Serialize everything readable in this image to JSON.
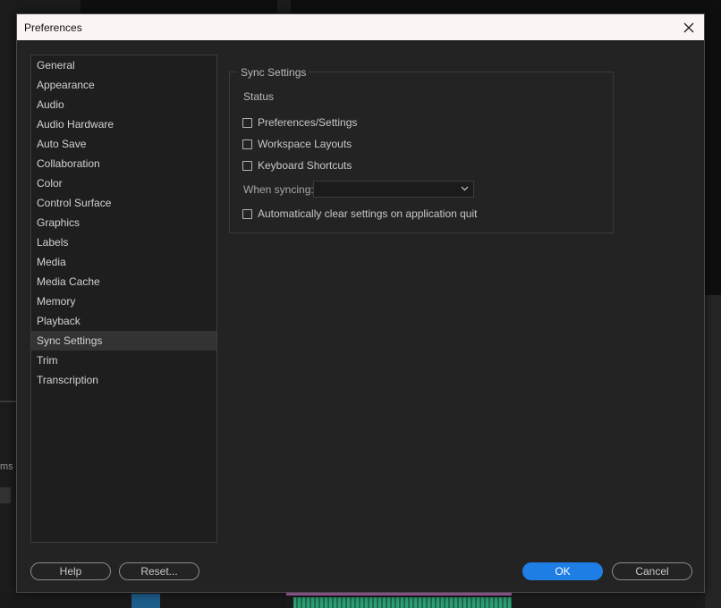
{
  "window": {
    "title": "Preferences"
  },
  "sidebar": {
    "items": [
      {
        "label": "General"
      },
      {
        "label": "Appearance"
      },
      {
        "label": "Audio"
      },
      {
        "label": "Audio Hardware"
      },
      {
        "label": "Auto Save"
      },
      {
        "label": "Collaboration"
      },
      {
        "label": "Color"
      },
      {
        "label": "Control Surface"
      },
      {
        "label": "Graphics"
      },
      {
        "label": "Labels"
      },
      {
        "label": "Media"
      },
      {
        "label": "Media Cache"
      },
      {
        "label": "Memory"
      },
      {
        "label": "Playback"
      },
      {
        "label": "Sync Settings"
      },
      {
        "label": "Trim"
      },
      {
        "label": "Transcription"
      }
    ],
    "selected": "Sync Settings"
  },
  "sync": {
    "group_title": "Sync Settings",
    "status_label": "Status",
    "checkboxes": [
      {
        "label": "Preferences/Settings",
        "checked": false
      },
      {
        "label": "Workspace Layouts",
        "checked": false
      },
      {
        "label": "Keyboard Shortcuts",
        "checked": false
      }
    ],
    "when_syncing_label": "When syncing:",
    "when_syncing_value": "",
    "auto_clear": {
      "label": "Automatically clear settings on application quit",
      "checked": false
    }
  },
  "buttons": {
    "help": "Help",
    "reset": "Reset...",
    "ok": "OK",
    "cancel": "Cancel"
  },
  "background": {
    "left_fragment": "ms"
  },
  "colors": {
    "accent": "#1f7de6",
    "dialog_bg": "#232323",
    "titlebar_bg": "#faf4f2",
    "selected_row": "#333333"
  }
}
